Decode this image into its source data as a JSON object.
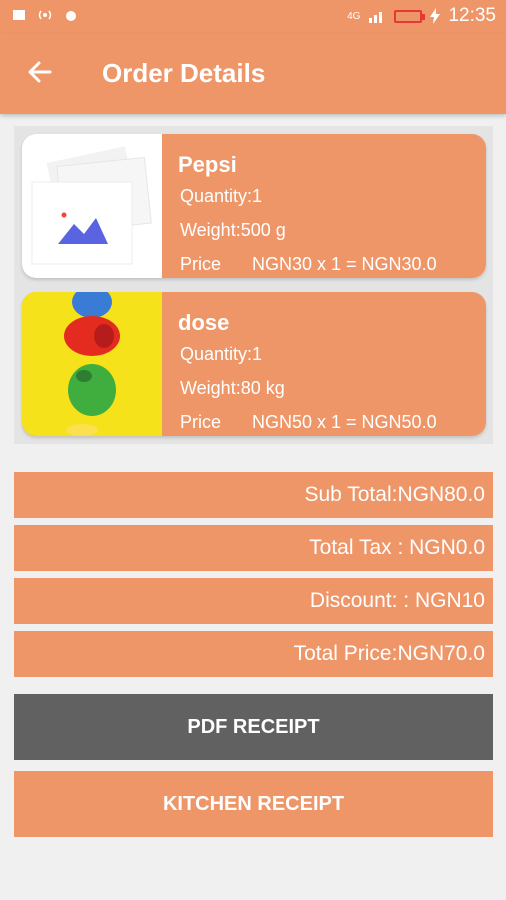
{
  "status_bar": {
    "time": "12:35",
    "network": "4G"
  },
  "app_bar": {
    "title": "Order Details"
  },
  "items": [
    {
      "name": "Pepsi",
      "quantity": "Quantity:1",
      "weight": "Weight:500 g",
      "price_label": "Price",
      "price_value": "NGN30 x 1 = NGN30.0"
    },
    {
      "name": "dose",
      "quantity": "Quantity:1",
      "weight": "Weight:80 kg",
      "price_label": "Price",
      "price_value": "NGN50 x 1 = NGN50.0"
    }
  ],
  "summary": {
    "sub_total": "Sub Total:NGN80.0",
    "total_tax": "Total Tax : NGN0.0",
    "discount": "Discount: : NGN10",
    "total_price": "Total Price:NGN70.0"
  },
  "buttons": {
    "pdf_receipt": "PDF RECEIPT",
    "kitchen_receipt": "KITCHEN RECEIPT"
  },
  "colors": {
    "accent": "#ef9669",
    "dark_button": "#616161",
    "background": "#f0f0f0"
  }
}
